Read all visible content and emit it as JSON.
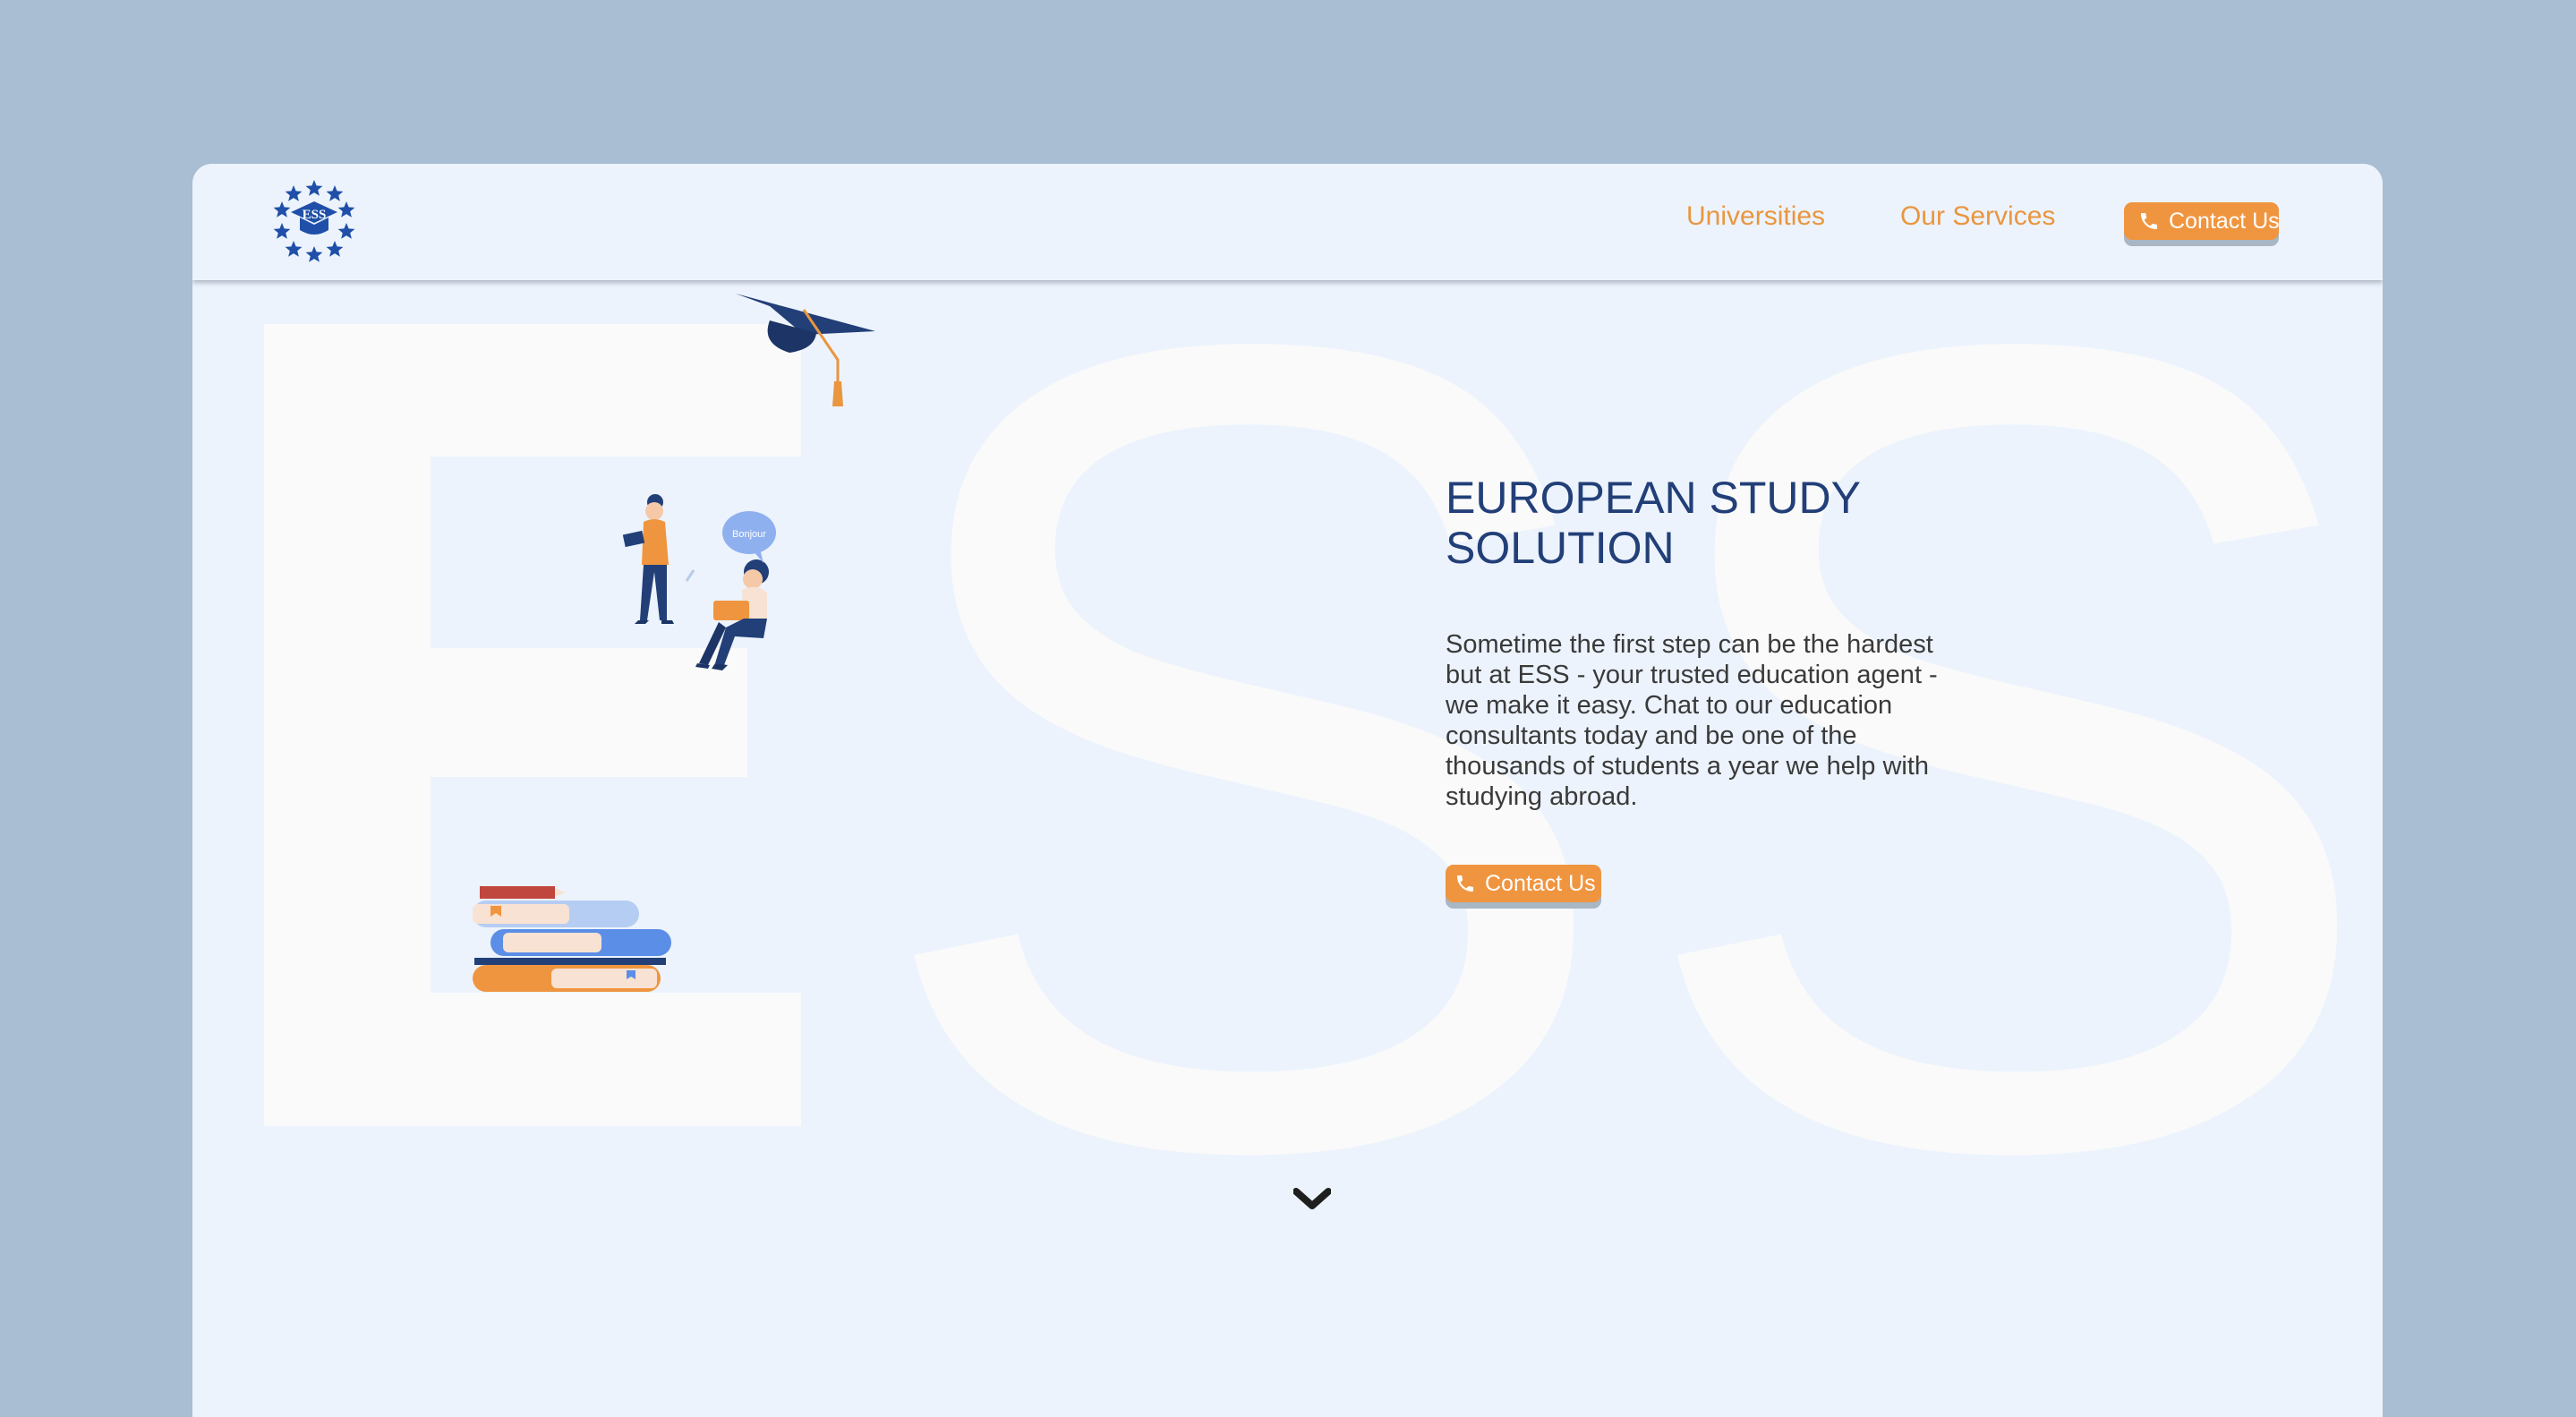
{
  "colors": {
    "page_bg": "#a9bdd3",
    "panel_bg": "#ecf3fc",
    "accent_orange": "#f0953f",
    "title_navy": "#223f78",
    "logo_blue": "#1f4fa8",
    "bg_letters": "#fafafa"
  },
  "header": {
    "logo_icon": "ess-star-ring-logo",
    "logo_text": "ESS",
    "nav": [
      {
        "label": "Universities"
      },
      {
        "label": "Our Services"
      }
    ],
    "contact_label": "Contact Us",
    "contact_icon": "phone-icon"
  },
  "background_letters": "ESS",
  "hero": {
    "title": "EUROPEAN STUDY SOLUTION",
    "text": "Sometime the first step can be the hardest but at ESS - your trusted education agent - we make it easy. Chat to our education consultants today and be one of the thousands of students a year we help with studying abroad.",
    "cta_label": "Contact Us",
    "cta_icon": "phone-icon",
    "speech_bubble_text": "Bonjour"
  },
  "scroll_indicator_icon": "chevron-down-icon"
}
